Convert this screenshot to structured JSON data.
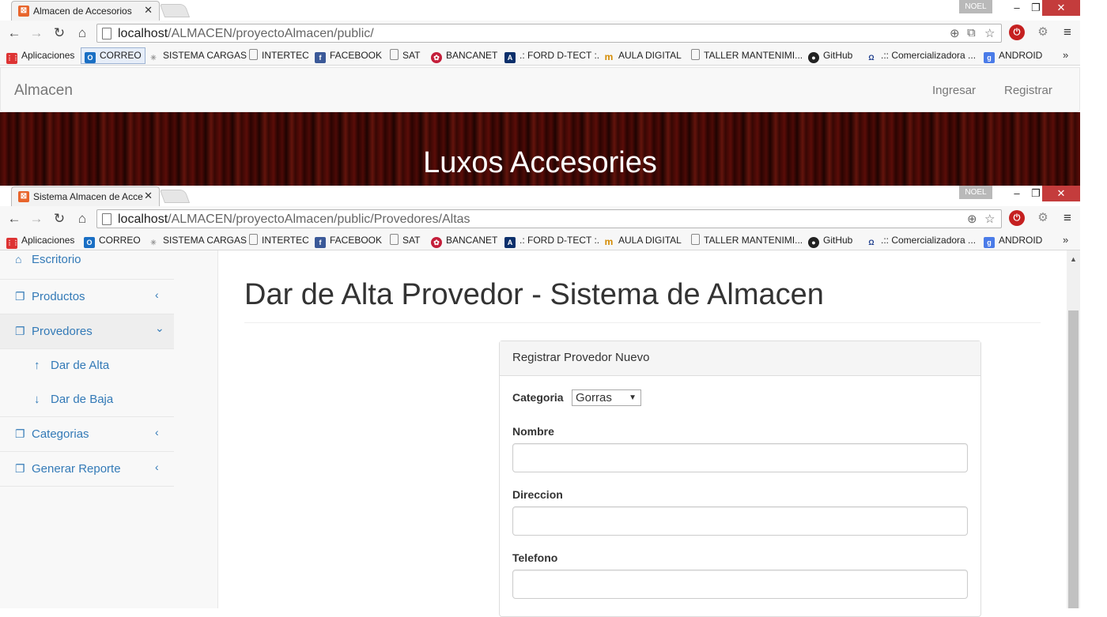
{
  "window1": {
    "tab_title": "Almacen de Accesorios",
    "user_label": "NOEL",
    "url_host": "localhost",
    "url_path": "/ALMACEN/proyectoAlmacen/public/",
    "site": {
      "brand": "Almacen",
      "nav_login": "Ingresar",
      "nav_register": "Registrar",
      "hero_title": "Luxos Accesories"
    }
  },
  "window2": {
    "tab_title": "Sistema Almacen de Acce",
    "user_label": "NOEL",
    "url_host": "localhost",
    "url_path": "/ALMACEN/proyectoAlmacen/public/Provedores/Altas"
  },
  "bookmarks": {
    "apps": "Aplicaciones",
    "correo": "CORREO",
    "sistema_cargas": "SISTEMA CARGAS",
    "intertec": "INTERTEC",
    "facebook": "FACEBOOK",
    "sat": "SAT",
    "bancanet": "BANCANET",
    "ford": ".: FORD D-TECT :.",
    "aula": "AULA DIGITAL",
    "taller": "TALLER MANTENIMI...",
    "github": "GitHub",
    "comercializadora": ".:: Comercializadora ...",
    "android": "ANDROID",
    "more": "»"
  },
  "sidebar": {
    "escritorio": "Escritorio",
    "productos": "Productos",
    "provedores": "Provedores",
    "dar_alta": "Dar de Alta",
    "dar_baja": "Dar de Baja",
    "categorias": "Categorias",
    "generar_reporte": "Generar Reporte"
  },
  "main": {
    "page_title": "Dar de Alta Provedor - Sistema de Almacen",
    "panel_title": "Registrar Provedor Nuevo",
    "categoria_label": "Categoria",
    "categoria_value": "Gorras",
    "nombre_label": "Nombre",
    "direccion_label": "Direccion",
    "telefono_label": "Telefono"
  },
  "colors": {
    "link": "#337ab7",
    "close_button": "#c43c3c",
    "hero_background": "#3a0704"
  }
}
